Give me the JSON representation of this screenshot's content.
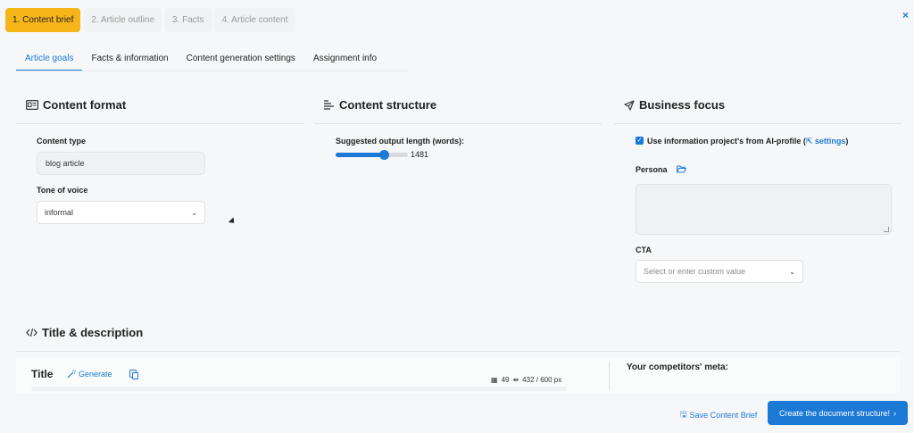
{
  "steps": [
    "1. Content brief",
    "2. Article outline",
    "3. Facts",
    "4. Article content"
  ],
  "close_glyph": "×",
  "tabs": [
    "Article goals",
    "Facts & information",
    "Content generation settings",
    "Assignment info"
  ],
  "content_format": {
    "title": "Content format",
    "icon": "id-card-icon",
    "content_type_label": "Content type",
    "content_type_value": "blog article",
    "tone_label": "Tone of voice",
    "tone_value": "informal"
  },
  "content_structure": {
    "title": "Content structure",
    "icon": "text-align-left-icon",
    "length_label": "Suggested output length (words):",
    "length_value": "1481",
    "slider_fraction": 0.7
  },
  "business_focus": {
    "title": "Business focus",
    "icon": "send-icon",
    "checkbox_text": "Use information project's from AI-profile (",
    "settings_link": "settings",
    "close_paren": ")",
    "persona_label": "Persona",
    "persona_value": "",
    "cta_label": "CTA",
    "cta_placeholder": "Select or enter custom value"
  },
  "title_description": {
    "title": "Title & description",
    "icon": "code-icon",
    "title_label": "Title",
    "generate_label": "Generate",
    "char_count": "49",
    "pixel_width": "432 / 600 px",
    "competitors_label": "Your competitors' meta:"
  },
  "footer": {
    "save_label": "Save Content Brief",
    "primary_label": "Create the document structure!",
    "primary_chevron": "›"
  },
  "colors": {
    "accent": "#1c79d6",
    "step_active": "#f6b519"
  }
}
